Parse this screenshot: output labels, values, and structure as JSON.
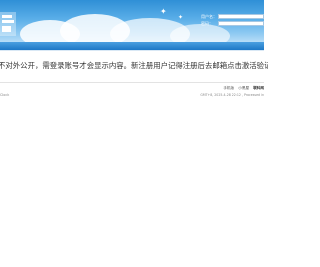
{
  "header": {
    "login_form": {
      "username_label": "用户名：",
      "password_label": "密码："
    }
  },
  "notice": {
    "text": "不对外公开，需登录账号才会显示内容。新注册用户记得注册后去邮箱点击激活验证邮件，"
  },
  "footer": {
    "links": [
      "手机版",
      "小黑屋",
      "联科网"
    ],
    "left_text": "Clock",
    "right_text": "GMT+8, 2025-4-28 22:12 , Processed in"
  },
  "colors": {
    "header_top": "#2f8fd6",
    "navbar": "#1d78c6",
    "text": "#333333"
  }
}
